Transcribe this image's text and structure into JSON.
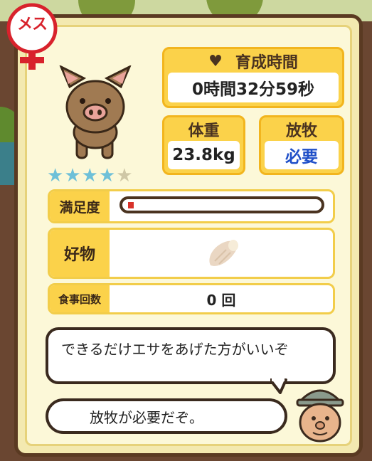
{
  "badge": {
    "label": "メス",
    "icon": "female-symbol-icon"
  },
  "pet": {
    "icon": "pig-icon",
    "rating": 4,
    "rating_max": 5
  },
  "growth_time": {
    "label": "育成時間",
    "value": "0時間32分59秒"
  },
  "weight": {
    "label": "体重",
    "value": "23.8kg"
  },
  "grazing": {
    "label": "放牧",
    "value": "必要"
  },
  "satisfaction": {
    "label": "満足度",
    "level": 0.03
  },
  "favorite": {
    "label": "好物",
    "icon": "sweet-potato-icon"
  },
  "meals": {
    "label": "食事回数",
    "value": "0 回"
  },
  "messages": {
    "hint": "できるだけエサをあげた方がいいぞ",
    "farmer": "放牧が必要だぞ。"
  },
  "colors": {
    "accent": "#fbd24a",
    "brand_red": "#d8222c",
    "blue_text": "#1f4fc8"
  }
}
